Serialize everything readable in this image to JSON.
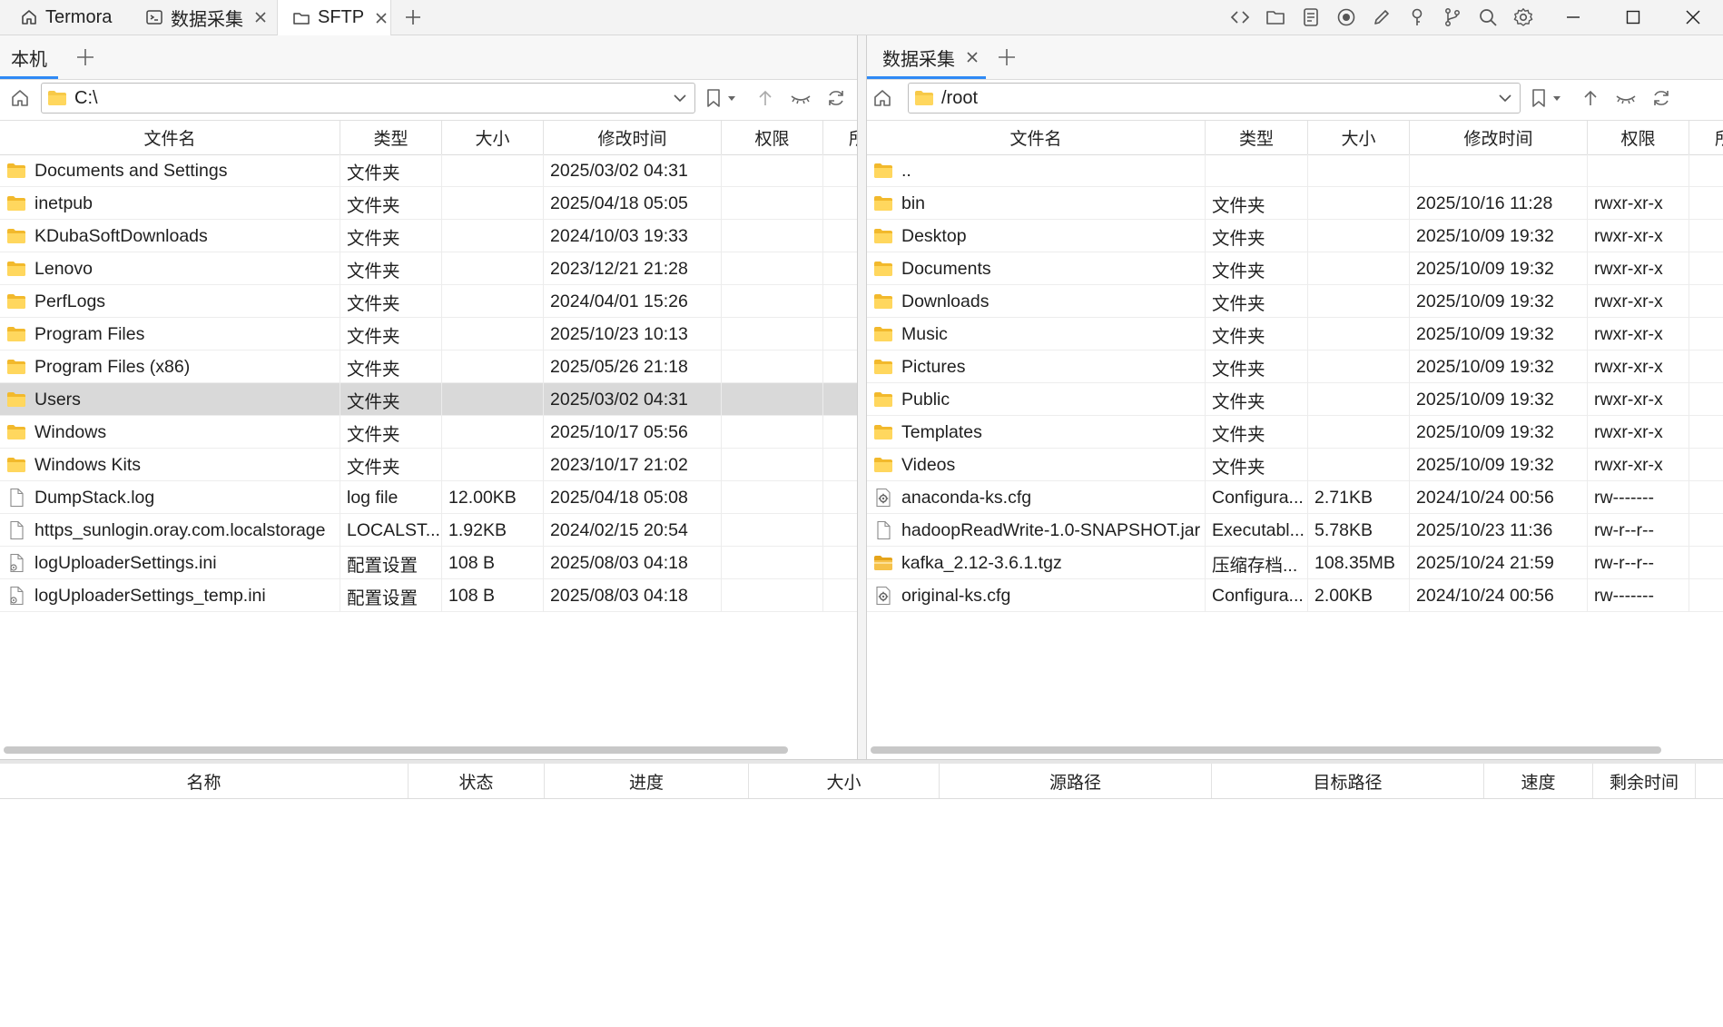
{
  "titlebar": {
    "tabs": [
      {
        "label": "Termora",
        "icon": "home-icon"
      },
      {
        "label": "数据采集",
        "icon": "terminal-icon"
      },
      {
        "label": "SFTP",
        "icon": "folder-icon"
      }
    ],
    "toolbar_icons": [
      "code-icon",
      "folder-icon",
      "notes-icon",
      "record-icon",
      "pen-icon",
      "key-icon",
      "branch-icon",
      "search-icon",
      "gear-icon"
    ],
    "window_controls": [
      "minimize-icon",
      "maximize-icon",
      "close-icon"
    ]
  },
  "left": {
    "tab_label": "本机",
    "path": "C:\\",
    "columns": [
      "文件名",
      "类型",
      "大小",
      "修改时间",
      "权限",
      "所"
    ],
    "rows": [
      {
        "name": "Documents and Settings",
        "type": "文件夹",
        "size": "",
        "mtime": "2025/03/02 04:31",
        "icon": "folder",
        "selected": false
      },
      {
        "name": "inetpub",
        "type": "文件夹",
        "size": "",
        "mtime": "2025/04/18 05:05",
        "icon": "folder",
        "selected": false
      },
      {
        "name": "KDubaSoftDownloads",
        "type": "文件夹",
        "size": "",
        "mtime": "2024/10/03 19:33",
        "icon": "folder",
        "selected": false
      },
      {
        "name": "Lenovo",
        "type": "文件夹",
        "size": "",
        "mtime": "2023/12/21 21:28",
        "icon": "folder",
        "selected": false
      },
      {
        "name": "PerfLogs",
        "type": "文件夹",
        "size": "",
        "mtime": "2024/04/01 15:26",
        "icon": "folder",
        "selected": false
      },
      {
        "name": "Program Files",
        "type": "文件夹",
        "size": "",
        "mtime": "2025/10/23 10:13",
        "icon": "folder",
        "selected": false
      },
      {
        "name": "Program Files (x86)",
        "type": "文件夹",
        "size": "",
        "mtime": "2025/05/26 21:18",
        "icon": "folder",
        "selected": false
      },
      {
        "name": "Users",
        "type": "文件夹",
        "size": "",
        "mtime": "2025/03/02 04:31",
        "icon": "folder",
        "selected": true
      },
      {
        "name": "Windows",
        "type": "文件夹",
        "size": "",
        "mtime": "2025/10/17 05:56",
        "icon": "folder",
        "selected": false
      },
      {
        "name": "Windows Kits",
        "type": "文件夹",
        "size": "",
        "mtime": "2023/10/17 21:02",
        "icon": "folder",
        "selected": false
      },
      {
        "name": "DumpStack.log",
        "type": "log file",
        "size": "12.00KB",
        "mtime": "2025/04/18 05:08",
        "icon": "file",
        "selected": false
      },
      {
        "name": "https_sunlogin.oray.com.localstorage",
        "type": "LOCALST...",
        "size": "1.92KB",
        "mtime": "2024/02/15 20:54",
        "icon": "file",
        "selected": false
      },
      {
        "name": "logUploaderSettings.ini",
        "type": "配置设置",
        "size": "108 B",
        "mtime": "2025/08/03 04:18",
        "icon": "ini",
        "selected": false
      },
      {
        "name": "logUploaderSettings_temp.ini",
        "type": "配置设置",
        "size": "108 B",
        "mtime": "2025/08/03 04:18",
        "icon": "ini",
        "selected": false
      }
    ]
  },
  "right": {
    "tab_label": "数据采集",
    "path": "/root",
    "columns": [
      "文件名",
      "类型",
      "大小",
      "修改时间",
      "权限",
      "所"
    ],
    "rows": [
      {
        "name": "..",
        "type": "",
        "size": "",
        "mtime": "",
        "perm": "",
        "icon": "folder"
      },
      {
        "name": "bin",
        "type": "文件夹",
        "size": "",
        "mtime": "2025/10/16 11:28",
        "perm": "rwxr-xr-x",
        "icon": "folder"
      },
      {
        "name": "Desktop",
        "type": "文件夹",
        "size": "",
        "mtime": "2025/10/09 19:32",
        "perm": "rwxr-xr-x",
        "icon": "folder"
      },
      {
        "name": "Documents",
        "type": "文件夹",
        "size": "",
        "mtime": "2025/10/09 19:32",
        "perm": "rwxr-xr-x",
        "icon": "folder"
      },
      {
        "name": "Downloads",
        "type": "文件夹",
        "size": "",
        "mtime": "2025/10/09 19:32",
        "perm": "rwxr-xr-x",
        "icon": "folder"
      },
      {
        "name": "Music",
        "type": "文件夹",
        "size": "",
        "mtime": "2025/10/09 19:32",
        "perm": "rwxr-xr-x",
        "icon": "folder"
      },
      {
        "name": "Pictures",
        "type": "文件夹",
        "size": "",
        "mtime": "2025/10/09 19:32",
        "perm": "rwxr-xr-x",
        "icon": "folder"
      },
      {
        "name": "Public",
        "type": "文件夹",
        "size": "",
        "mtime": "2025/10/09 19:32",
        "perm": "rwxr-xr-x",
        "icon": "folder"
      },
      {
        "name": "Templates",
        "type": "文件夹",
        "size": "",
        "mtime": "2025/10/09 19:32",
        "perm": "rwxr-xr-x",
        "icon": "folder"
      },
      {
        "name": "Videos",
        "type": "文件夹",
        "size": "",
        "mtime": "2025/10/09 19:32",
        "perm": "rwxr-xr-x",
        "icon": "folder"
      },
      {
        "name": "anaconda-ks.cfg",
        "type": "Configura...",
        "size": "2.71KB",
        "mtime": "2024/10/24 00:56",
        "perm": "rw-------",
        "icon": "cfg"
      },
      {
        "name": "hadoopReadWrite-1.0-SNAPSHOT.jar",
        "type": "Executabl...",
        "size": "5.78KB",
        "mtime": "2025/10/23 11:36",
        "perm": "rw-r--r--",
        "icon": "file"
      },
      {
        "name": "kafka_2.12-3.6.1.tgz",
        "type": "压缩存档...",
        "size": "108.35MB",
        "mtime": "2025/10/24 21:59",
        "perm": "rw-r--r--",
        "icon": "archive"
      },
      {
        "name": "original-ks.cfg",
        "type": "Configura...",
        "size": "2.00KB",
        "mtime": "2024/10/24 00:56",
        "perm": "rw-------",
        "icon": "cfg"
      }
    ]
  },
  "transfer": {
    "columns": [
      "名称",
      "状态",
      "进度",
      "大小",
      "源路径",
      "目标路径",
      "速度",
      "剩余时间"
    ]
  },
  "colors": {
    "accent": "#2f8af5",
    "folder": "#f7c948",
    "selected_row": "#d9d9d9"
  }
}
